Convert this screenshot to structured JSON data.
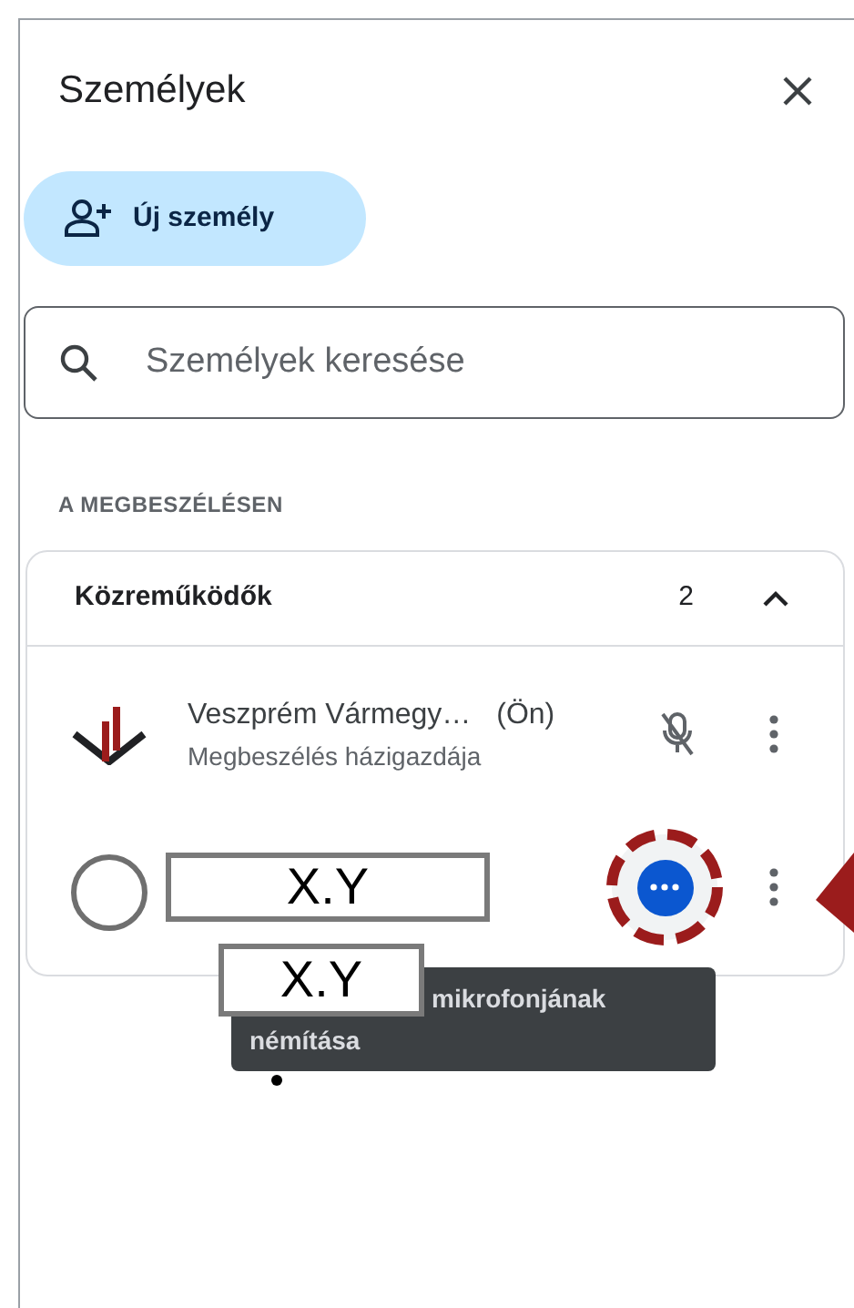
{
  "panel": {
    "title": "Személyek"
  },
  "new_person_button": {
    "label": "Új személy"
  },
  "search": {
    "placeholder": "Személyek keresése"
  },
  "section_label": "A MEGBESZÉLÉSEN",
  "group": {
    "title": "Közreműködők",
    "count": "2",
    "expanded": true
  },
  "participants": [
    {
      "kind": "host",
      "name": "Veszprém Vármegy…",
      "tag": "(Ön)",
      "role": "Megbeszélés házigazdája",
      "muted": true
    },
    {
      "kind": "redacted",
      "name": "X.Y",
      "muted": false
    }
  ],
  "tooltip": {
    "redaction": "X.Y",
    "lines": [
      "mikrofonjának",
      "némítása"
    ]
  }
}
